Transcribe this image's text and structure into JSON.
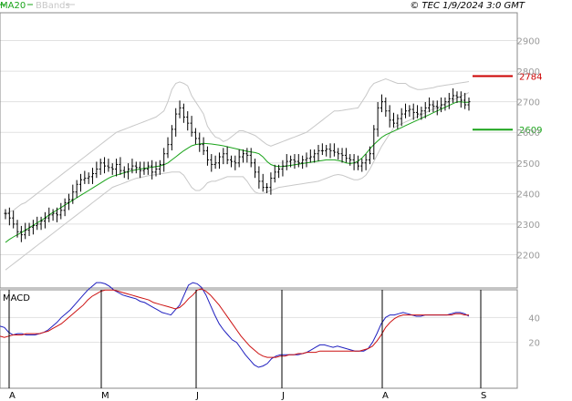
{
  "header": {
    "legend_ma20": "MA20",
    "legend_bbands": "BBands",
    "copyright": "© TEC 1/9/2024 3:0 GMT"
  },
  "colors": {
    "ma20": "#19a319",
    "bbands": "#c8c8c8",
    "candle": "#000000",
    "resistance": "#cc0000",
    "support": "#19a319",
    "macd": "#1f1fbf",
    "signal": "#cc1010",
    "grid": "#e1e1e1",
    "axis_text": "#9a9a9a"
  },
  "chart_data": [
    {
      "type": "candlestick",
      "title": "",
      "x_categories": [
        "A",
        "M",
        "J",
        "J",
        "A",
        "S"
      ],
      "ylim": [
        2100,
        3000
      ],
      "yticks": [
        "2900",
        "2800",
        "2700",
        "2600",
        "2500",
        "2400",
        "2300",
        "2200"
      ],
      "grid": true,
      "series": [
        {
          "name": "price",
          "values": [
            2335,
            2320,
            2300,
            2275,
            2265,
            2280,
            2290,
            2295,
            2300,
            2310,
            2320,
            2330,
            2335,
            2330,
            2345,
            2370,
            2380,
            2405,
            2430,
            2445,
            2450,
            2455,
            2465,
            2480,
            2500,
            2490,
            2485,
            2480,
            2495,
            2475,
            2470,
            2480,
            2490,
            2485,
            2475,
            2480,
            2490,
            2470,
            2480,
            2495,
            2530,
            2560,
            2610,
            2660,
            2680,
            2650,
            2630,
            2600,
            2580,
            2560,
            2540,
            2510,
            2495,
            2500,
            2520,
            2530,
            2510,
            2505,
            2500,
            2520,
            2530,
            2525,
            2500,
            2470,
            2440,
            2420,
            2420,
            2450,
            2470,
            2480,
            2490,
            2505,
            2510,
            2505,
            2500,
            2510,
            2515,
            2520,
            2530,
            2540,
            2540,
            2545,
            2540,
            2535,
            2530,
            2525,
            2515,
            2510,
            2500,
            2490,
            2500,
            2510,
            2530,
            2610,
            2680,
            2700,
            2670,
            2640,
            2630,
            2645,
            2660,
            2670,
            2675,
            2665,
            2660,
            2670,
            2680,
            2690,
            2685,
            2680,
            2690,
            2700,
            2710,
            2720,
            2715,
            2705,
            2690,
            2700
          ]
        },
        {
          "name": "MA20",
          "values": [
            2240,
            2250,
            2258,
            2265,
            2272,
            2280,
            2288,
            2296,
            2304,
            2312,
            2320,
            2330,
            2338,
            2346,
            2354,
            2362,
            2370,
            2378,
            2386,
            2394,
            2402,
            2410,
            2418,
            2426,
            2434,
            2442,
            2450,
            2456,
            2460,
            2464,
            2468,
            2472,
            2475,
            2478,
            2480,
            2482,
            2484,
            2486,
            2488,
            2490,
            2494,
            2500,
            2510,
            2520,
            2530,
            2540,
            2548,
            2556,
            2560,
            2562,
            2564,
            2563,
            2562,
            2560,
            2558,
            2556,
            2553,
            2550,
            2547,
            2544,
            2541,
            2538,
            2536,
            2534,
            2530,
            2520,
            2505,
            2495,
            2490,
            2488,
            2488,
            2490,
            2492,
            2494,
            2496,
            2498,
            2500,
            2502,
            2504,
            2506,
            2508,
            2510,
            2510,
            2510,
            2508,
            2505,
            2500,
            2498,
            2500,
            2506,
            2516,
            2530,
            2546,
            2560,
            2572,
            2584,
            2592,
            2598,
            2604,
            2610,
            2616,
            2622,
            2628,
            2634,
            2640,
            2646,
            2652,
            2658,
            2664,
            2670,
            2676,
            2682,
            2688,
            2694,
            2700,
            2700,
            2698,
            2698
          ]
        },
        {
          "name": "BB upper",
          "values": [
            2150,
            2160,
            2170,
            2180,
            2190,
            2200,
            2210,
            2220,
            2230,
            2240,
            2250,
            2260,
            2270,
            2280,
            2290,
            2300,
            2310,
            2320,
            2330,
            2340,
            2350,
            2360,
            2370,
            2380,
            2390,
            2400,
            2410,
            2420,
            2425,
            2430,
            2435,
            2440,
            2445,
            2450,
            2452,
            2455,
            2458,
            2460,
            2462,
            2464,
            2466,
            2468,
            2470,
            2470,
            2470,
            2460,
            2440,
            2420,
            2410,
            2410,
            2420,
            2435,
            2440,
            2440,
            2445,
            2450,
            2455,
            2455,
            2455,
            2455,
            2455,
            2440,
            2420,
            2405,
            2400,
            2400,
            2405,
            2410,
            2415,
            2420,
            2422,
            2424,
            2426,
            2428,
            2430,
            2432,
            2434,
            2436,
            2438,
            2440,
            2445,
            2450,
            2455,
            2460,
            2462,
            2460,
            2455,
            2450,
            2445,
            2445,
            2450,
            2460,
            2480,
            2505,
            2530,
            2555,
            2575,
            2595,
            2615,
            2622,
            2628,
            2634,
            2640,
            2646,
            2652,
            2658,
            2664,
            2670,
            2676,
            2682,
            2688,
            2694,
            2700,
            2706,
            2712,
            2718,
            2724,
            2730
          ]
        },
        {
          "name": "BB lower",
          "values": [
            2330,
            2340,
            2345,
            2355,
            2365,
            2370,
            2380,
            2390,
            2400,
            2410,
            2420,
            2430,
            2440,
            2450,
            2460,
            2470,
            2480,
            2490,
            2500,
            2510,
            2520,
            2530,
            2540,
            2550,
            2560,
            2570,
            2580,
            2590,
            2600,
            2605,
            2610,
            2615,
            2620,
            2625,
            2630,
            2635,
            2640,
            2645,
            2650,
            2660,
            2670,
            2700,
            2740,
            2760,
            2765,
            2760,
            2752,
            2720,
            2700,
            2680,
            2660,
            2620,
            2600,
            2585,
            2580,
            2570,
            2575,
            2585,
            2595,
            2605,
            2605,
            2600,
            2595,
            2590,
            2580,
            2570,
            2560,
            2555,
            2560,
            2565,
            2570,
            2575,
            2580,
            2585,
            2590,
            2595,
            2600,
            2610,
            2620,
            2630,
            2640,
            2650,
            2660,
            2670,
            2670,
            2672,
            2674,
            2676,
            2678,
            2680,
            2700,
            2720,
            2745,
            2760,
            2765,
            2770,
            2775,
            2770,
            2765,
            2760,
            2760,
            2760,
            2750,
            2745,
            2740,
            2740,
            2742,
            2744,
            2746,
            2750,
            2752,
            2754,
            2756,
            2758,
            2760,
            2762,
            2764,
            2766
          ]
        }
      ],
      "levels": [
        {
          "name": "resistance",
          "value": 2784,
          "label": "2784"
        },
        {
          "name": "support",
          "value": 2609,
          "label": "2609"
        }
      ]
    },
    {
      "type": "line",
      "title": "MACD",
      "ylim": [
        0,
        60
      ],
      "yticks": [
        "40",
        "20"
      ],
      "series": [
        {
          "name": "MACD",
          "values": [
            33,
            32,
            28,
            26,
            27,
            27,
            26,
            26,
            26,
            27,
            28,
            30,
            33,
            36,
            40,
            43,
            46,
            50,
            54,
            58,
            62,
            65,
            68,
            68,
            67,
            65,
            62,
            60,
            58,
            57,
            56,
            55,
            53,
            52,
            50,
            48,
            46,
            44,
            43,
            42,
            46,
            50,
            58,
            66,
            68,
            67,
            64,
            58,
            50,
            42,
            35,
            30,
            26,
            22,
            20,
            15,
            10,
            6,
            2,
            0,
            1,
            3,
            7,
            9,
            10,
            10,
            10,
            10,
            10,
            11,
            12,
            14,
            16,
            18,
            18,
            17,
            16,
            17,
            16,
            15,
            14,
            13,
            13,
            13,
            15,
            20,
            27,
            35,
            40,
            42,
            42,
            43,
            44,
            43,
            42,
            41,
            41,
            42,
            42,
            42,
            42,
            42,
            42,
            43,
            44,
            44,
            43,
            41
          ]
        },
        {
          "name": "Signal",
          "values": [
            25,
            24,
            25,
            26,
            26,
            26,
            27,
            27,
            27,
            27,
            28,
            29,
            31,
            33,
            35,
            38,
            41,
            44,
            47,
            50,
            54,
            57,
            59,
            61,
            62,
            62,
            62,
            61,
            60,
            59,
            58,
            57,
            56,
            55,
            54,
            52,
            51,
            50,
            49,
            48,
            47,
            48,
            51,
            55,
            58,
            62,
            63,
            61,
            58,
            54,
            50,
            45,
            40,
            35,
            30,
            25,
            21,
            17,
            14,
            11,
            9,
            8,
            8,
            8,
            9,
            9,
            10,
            10,
            11,
            11,
            12,
            12,
            12,
            13,
            13,
            13,
            13,
            13,
            13,
            13,
            13,
            13,
            13,
            14,
            15,
            17,
            21,
            26,
            32,
            36,
            39,
            41,
            42,
            42,
            42,
            42,
            42,
            42,
            42,
            42,
            42,
            42,
            42,
            42,
            43,
            43,
            42,
            42
          ]
        }
      ]
    }
  ]
}
